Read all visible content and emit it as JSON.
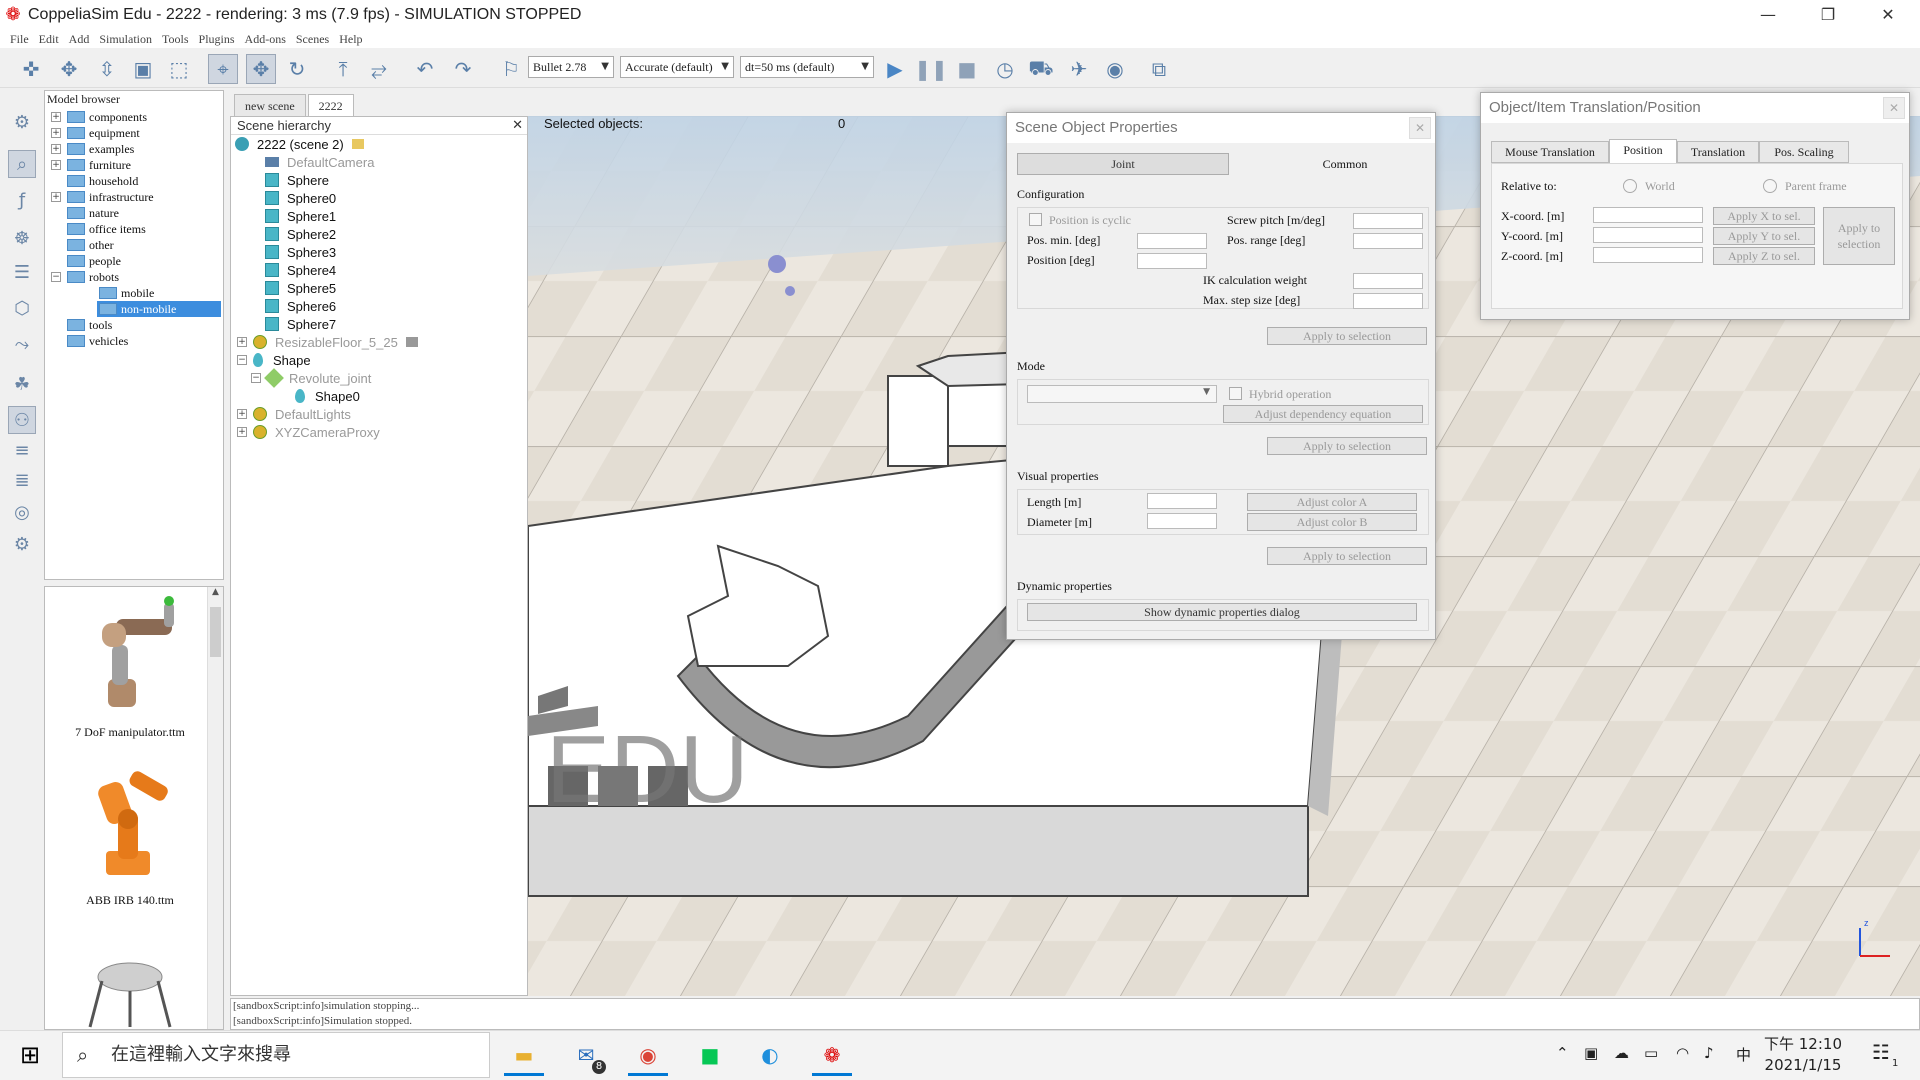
{
  "window": {
    "title": "CoppeliaSim Edu - 2222 - rendering: 3 ms (7.9 fps) - SIMULATION STOPPED"
  },
  "menu": [
    "File",
    "Edit",
    "Add",
    "Simulation",
    "Tools",
    "Plugins",
    "Add-ons",
    "Scenes",
    "Help"
  ],
  "toolbar": {
    "physics_engine": "Bullet 2.78",
    "accuracy": "Accurate (default)",
    "timestep": "dt=50 ms (default)"
  },
  "model_browser": {
    "header": "Model browser",
    "items": [
      {
        "label": "components"
      },
      {
        "label": "equipment"
      },
      {
        "label": "examples"
      },
      {
        "label": "furniture"
      },
      {
        "label": "household"
      },
      {
        "label": "infrastructure"
      },
      {
        "label": "nature"
      },
      {
        "label": "office items"
      },
      {
        "label": "other"
      },
      {
        "label": "people"
      },
      {
        "label": "robots"
      },
      {
        "label": "mobile"
      },
      {
        "label": "non-mobile"
      },
      {
        "label": "tools"
      },
      {
        "label": "vehicles"
      }
    ],
    "thumbnails": [
      {
        "label": "7 DoF manipulator.ttm"
      },
      {
        "label": "ABB IRB 140.ttm"
      }
    ]
  },
  "scene_tabs": [
    "new scene",
    "2222"
  ],
  "hierarchy": {
    "header": "Scene hierarchy",
    "items": [
      {
        "label": "2222 (scene 2)"
      },
      {
        "label": "DefaultCamera"
      },
      {
        "label": "Sphere"
      },
      {
        "label": "Sphere0"
      },
      {
        "label": "Sphere1"
      },
      {
        "label": "Sphere2"
      },
      {
        "label": "Sphere3"
      },
      {
        "label": "Sphere4"
      },
      {
        "label": "Sphere5"
      },
      {
        "label": "Sphere6"
      },
      {
        "label": "Sphere7"
      },
      {
        "label": "ResizableFloor_5_25"
      },
      {
        "label": "Shape"
      },
      {
        "label": "Revolute_joint"
      },
      {
        "label": "Shape0"
      },
      {
        "label": "DefaultLights"
      },
      {
        "label": "XYZCameraProxy"
      }
    ]
  },
  "viewport": {
    "selected_label": "Selected objects:",
    "selected_count": "0",
    "watermark": "EDU",
    "axis_z": "z"
  },
  "console": {
    "lines": [
      "[sandboxScript:info]simulation stopping...",
      "[sandboxScript:info]Simulation stopped."
    ]
  },
  "scene_object_properties": {
    "title": "Scene Object Properties",
    "tab_joint": "Joint",
    "tab_common": "Common",
    "section_configuration": "Configuration",
    "position_cyclic": "Position is cyclic",
    "screw_pitch": "Screw pitch [m/deg]",
    "pos_min": "Pos. min. [deg]",
    "pos_range": "Pos. range [deg]",
    "position": "Position [deg]",
    "ik_weight": "IK calculation weight",
    "max_step": "Max. step size [deg]",
    "apply": "Apply to selection",
    "section_mode": "Mode",
    "hybrid": "Hybrid operation",
    "adjust_dependency": "Adjust dependency equation",
    "section_visual": "Visual properties",
    "length": "Length [m]",
    "diameter": "Diameter [m]",
    "adjust_color_a": "Adjust color A",
    "adjust_color_b": "Adjust color B",
    "section_dynamic": "Dynamic properties",
    "show_dynamic": "Show dynamic properties dialog"
  },
  "translation_dialog": {
    "title": "Object/Item Translation/Position",
    "tabs": [
      "Mouse Translation",
      "Position",
      "Translation",
      "Pos. Scaling"
    ],
    "relative_to": "Relative to:",
    "world": "World",
    "parent_frame": "Parent frame",
    "x_coord": "X-coord. [m]",
    "y_coord": "Y-coord. [m]",
    "z_coord": "Z-coord. [m]",
    "apply_x": "Apply X to sel.",
    "apply_y": "Apply Y to sel.",
    "apply_z": "Apply Z to sel.",
    "apply_selection": "Apply to selection"
  },
  "taskbar": {
    "search_placeholder": "在這裡輸入文字來搜尋",
    "mail_badge": "8",
    "ime": "中",
    "time": "下午 12:10",
    "date": "2021/1/15",
    "notification_count": "1"
  },
  "colors": {
    "accent": "#3c8dde",
    "floor_light": "#e6e1d8",
    "sky": "#bfd3e6"
  }
}
